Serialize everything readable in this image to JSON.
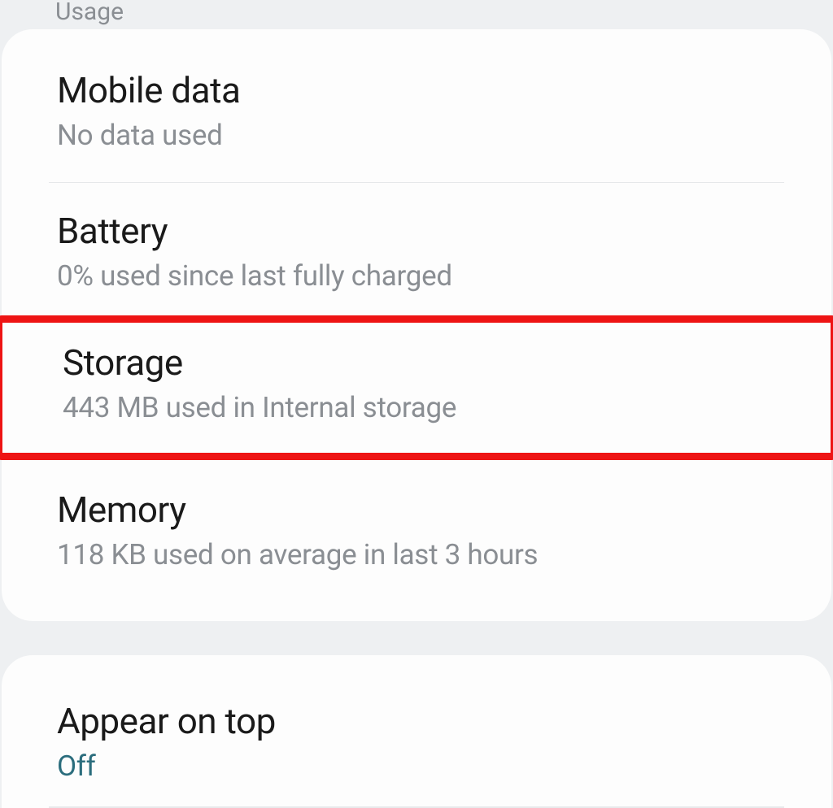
{
  "partialHeader": "Usage",
  "settings": {
    "mobileData": {
      "title": "Mobile data",
      "subtitle": "No data used"
    },
    "battery": {
      "title": "Battery",
      "subtitle": "0% used since last fully charged"
    },
    "storage": {
      "title": "Storage",
      "subtitle": "443 MB used in Internal storage"
    },
    "memory": {
      "title": "Memory",
      "subtitle": "118 KB used on average in last 3 hours"
    },
    "appearOnTop": {
      "title": "Appear on top",
      "subtitle": "Off"
    }
  }
}
